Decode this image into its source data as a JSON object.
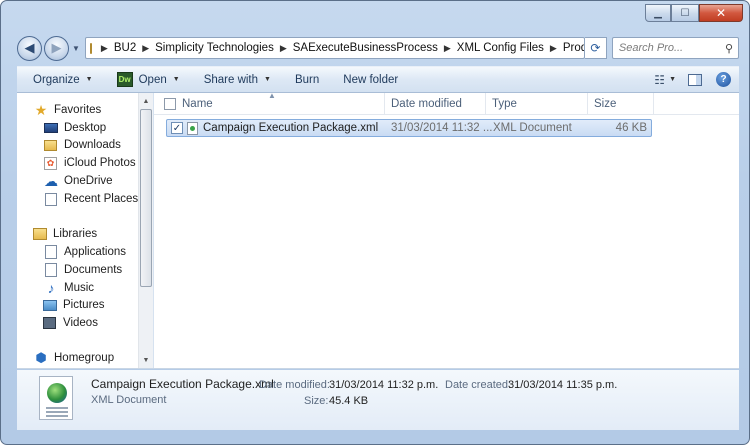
{
  "breadcrumb": [
    "BU2",
    "Simplicity Technologies",
    "SAExecuteBusinessProcess",
    "XML Config Files",
    "Production"
  ],
  "search": {
    "placeholder": "Search Pro..."
  },
  "toolbar": {
    "organize": "Organize",
    "open": "Open",
    "open_icon_text": "Dw",
    "share_with": "Share with",
    "burn": "Burn",
    "new_folder": "New folder"
  },
  "sidebar": {
    "favorites": {
      "label": "Favorites",
      "items": [
        "Desktop",
        "Downloads",
        "iCloud Photos",
        "OneDrive",
        "Recent Places"
      ]
    },
    "libraries": {
      "label": "Libraries",
      "items": [
        "Applications",
        "Documents",
        "Music",
        "Pictures",
        "Videos"
      ]
    },
    "homegroup": "Homegroup"
  },
  "columns": {
    "name": "Name",
    "date_modified": "Date modified",
    "type": "Type",
    "size": "Size"
  },
  "files": [
    {
      "name": "Campaign Execution Package.xml",
      "date_modified": "31/03/2014 11:32 ...",
      "type": "XML Document",
      "size": "46 KB",
      "selected": true
    }
  ],
  "details": {
    "name": "Campaign Execution Package.xml",
    "type": "XML Document",
    "date_modified_label": "Date modified:",
    "date_modified": "31/03/2014 11:32 p.m.",
    "date_created_label": "Date created:",
    "date_created": "31/03/2014 11:35 p.m.",
    "size_label": "Size:",
    "size": "45.4 KB"
  },
  "colors": {
    "accent": "#1d5fae",
    "selection": "#cde0f7",
    "chrome": "#b9cfe9"
  }
}
